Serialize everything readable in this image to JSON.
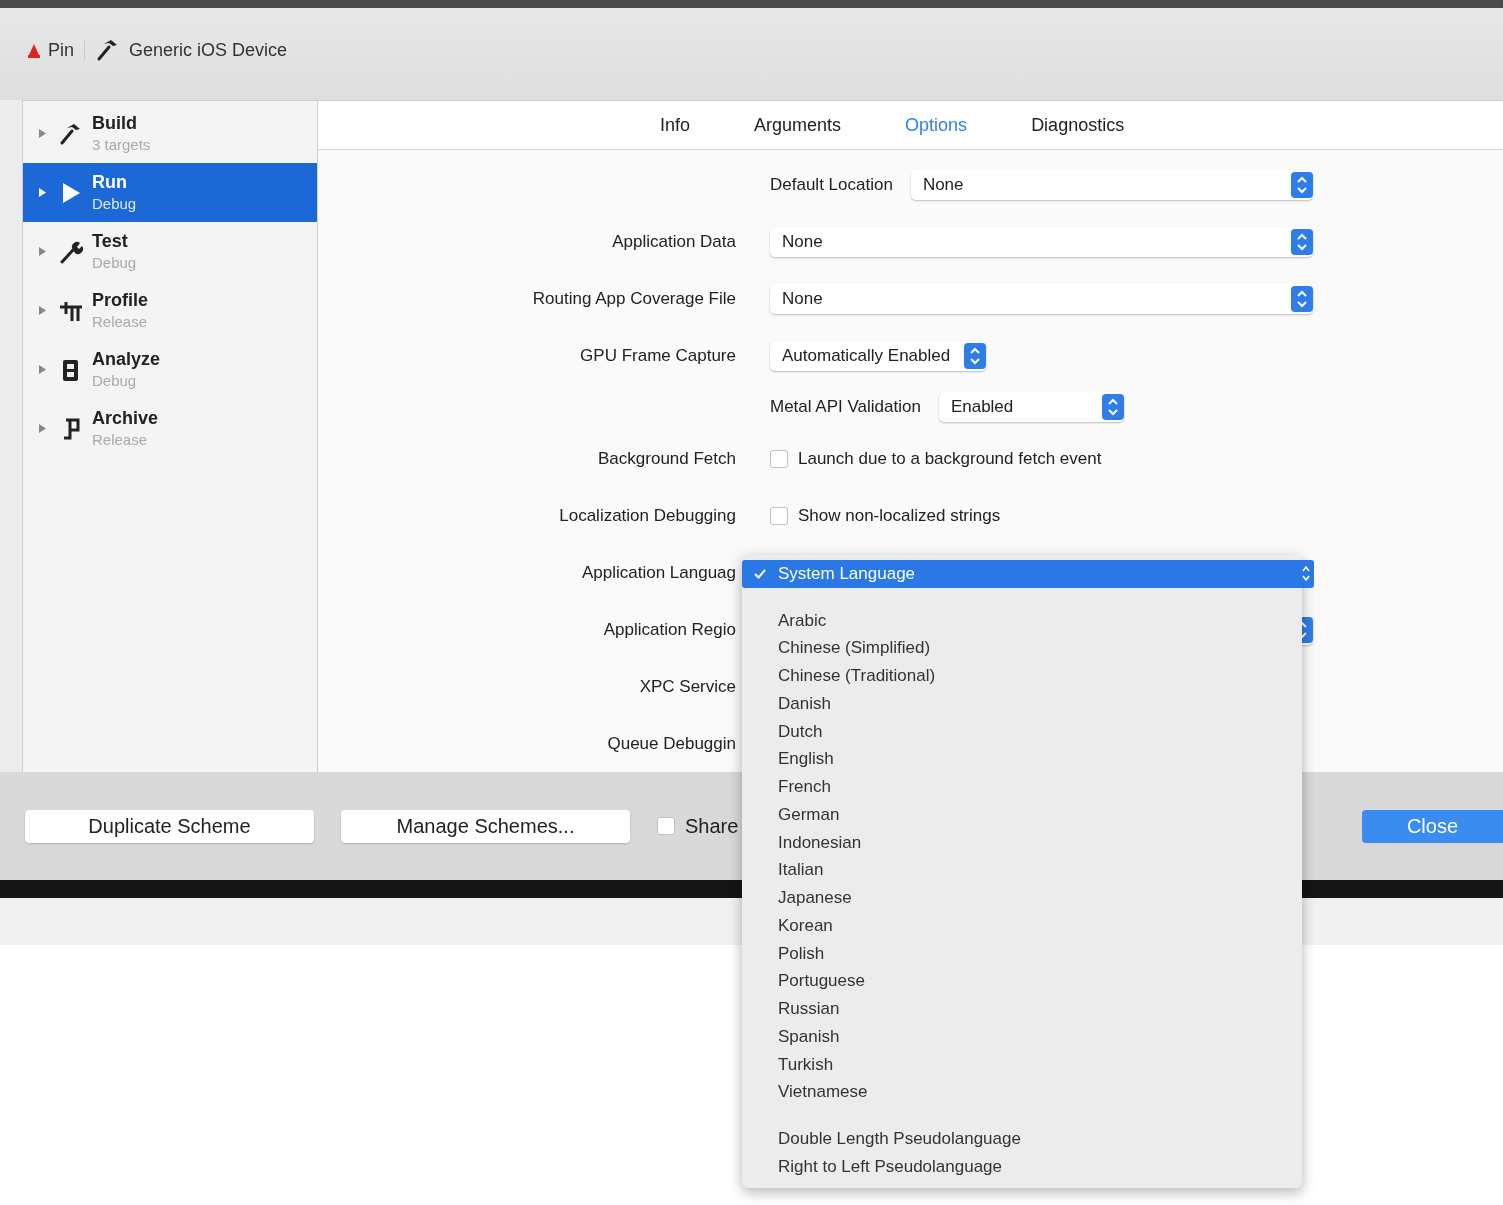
{
  "toolbar": {
    "scheme": "Pin",
    "destination": "Generic iOS Device"
  },
  "sidebar": {
    "items": [
      {
        "name": "Build",
        "subtitle": "3 targets",
        "selected": false
      },
      {
        "name": "Run",
        "subtitle": "Debug",
        "selected": true
      },
      {
        "name": "Test",
        "subtitle": "Debug",
        "selected": false
      },
      {
        "name": "Profile",
        "subtitle": "Release",
        "selected": false
      },
      {
        "name": "Analyze",
        "subtitle": "Debug",
        "selected": false
      },
      {
        "name": "Archive",
        "subtitle": "Release",
        "selected": false
      }
    ]
  },
  "tabs": [
    {
      "label": "Info",
      "selected": false
    },
    {
      "label": "Arguments",
      "selected": false
    },
    {
      "label": "Options",
      "selected": true
    },
    {
      "label": "Diagnostics",
      "selected": false
    }
  ],
  "form": {
    "rows": [
      {
        "kind": "subpopup",
        "label": "Default Location",
        "value": "None"
      },
      {
        "kind": "popup",
        "label": "Application Data",
        "value": "None"
      },
      {
        "kind": "popup",
        "label": "Routing App Coverage File",
        "value": "None"
      },
      {
        "kind": "shortpopup",
        "label": "GPU Frame Capture",
        "value": "Automatically Enabled"
      },
      {
        "kind": "shortsubpopup",
        "label": "Metal API Validation",
        "value": "Enabled"
      },
      {
        "kind": "checkbox",
        "label": "Background Fetch",
        "text": "Launch due to a background fetch event",
        "checked": false
      },
      {
        "kind": "checkbox",
        "label": "Localization Debugging",
        "text": "Show non-localized strings",
        "checked": false
      },
      {
        "kind": "label",
        "label": "Application Languag"
      },
      {
        "kind": "popup",
        "label": "Application Regio"
      },
      {
        "kind": "label",
        "label": "XPC Service"
      },
      {
        "kind": "label",
        "label": "Queue Debuggin"
      }
    ]
  },
  "menu": {
    "items": [
      {
        "kind": "item",
        "label": "System Language",
        "selected": true
      },
      {
        "kind": "separator"
      },
      {
        "kind": "item",
        "label": "Arabic",
        "selected": false
      },
      {
        "kind": "item",
        "label": "Chinese (Simplified)",
        "selected": false
      },
      {
        "kind": "item",
        "label": "Chinese (Traditional)",
        "selected": false
      },
      {
        "kind": "item",
        "label": "Danish",
        "selected": false
      },
      {
        "kind": "item",
        "label": "Dutch",
        "selected": false
      },
      {
        "kind": "item",
        "label": "English",
        "selected": false
      },
      {
        "kind": "item",
        "label": "French",
        "selected": false
      },
      {
        "kind": "item",
        "label": "German",
        "selected": false
      },
      {
        "kind": "item",
        "label": "Indonesian",
        "selected": false
      },
      {
        "kind": "item",
        "label": "Italian",
        "selected": false
      },
      {
        "kind": "item",
        "label": "Japanese",
        "selected": false
      },
      {
        "kind": "item",
        "label": "Korean",
        "selected": false
      },
      {
        "kind": "item",
        "label": "Polish",
        "selected": false
      },
      {
        "kind": "item",
        "label": "Portuguese",
        "selected": false
      },
      {
        "kind": "item",
        "label": "Russian",
        "selected": false
      },
      {
        "kind": "item",
        "label": "Spanish",
        "selected": false
      },
      {
        "kind": "item",
        "label": "Turkish",
        "selected": false
      },
      {
        "kind": "item",
        "label": "Vietnamese",
        "selected": false
      },
      {
        "kind": "separator"
      },
      {
        "kind": "item",
        "label": "Double Length Pseudolanguage",
        "selected": false
      },
      {
        "kind": "item",
        "label": "Right to Left Pseudolanguage",
        "selected": false
      }
    ]
  },
  "footer": {
    "buttons": [
      "Duplicate Scheme",
      "Manage Schemes..."
    ],
    "share": {
      "label": "Share",
      "checked": false
    },
    "close": "Close"
  }
}
